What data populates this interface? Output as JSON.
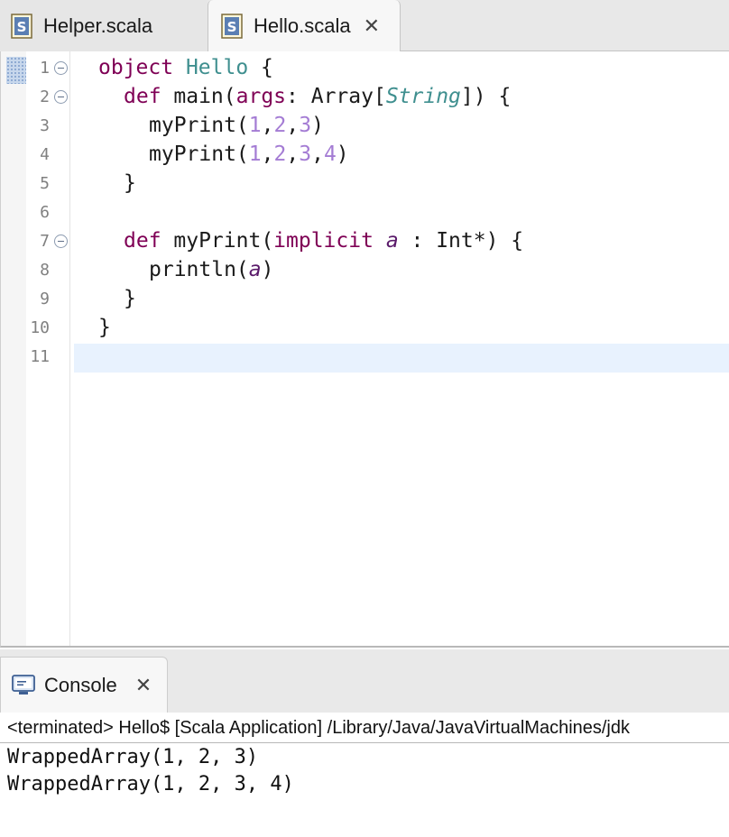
{
  "editor_tabs": [
    {
      "label": "Helper.scala",
      "icon": "scala-file-icon",
      "active": false
    },
    {
      "label": "Hello.scala",
      "icon": "scala-file-icon",
      "active": true,
      "close": "✕"
    }
  ],
  "editor": {
    "line_numbers": [
      "1",
      "2",
      "3",
      "4",
      "5",
      "6",
      "7",
      "8",
      "9",
      "10",
      "11"
    ],
    "current_line": 11,
    "code": {
      "l1": {
        "kw": "object",
        "name": "Hello",
        "rest": " {"
      },
      "l2": {
        "kw": "def",
        "pre": " main(",
        "param": "args",
        "mid": ": Array[",
        "type": "String",
        "post": "]) {"
      },
      "l3": {
        "pre": "myPrint(",
        "n1": "1",
        "c1": ",",
        "n2": "2",
        "c2": ",",
        "n3": "3",
        "post": ")"
      },
      "l4": {
        "pre": "myPrint(",
        "n1": "1",
        "c1": ",",
        "n2": "2",
        "c2": ",",
        "n3": "3",
        "c3": ",",
        "n4": "4",
        "post": ")"
      },
      "l5": "}",
      "l7": {
        "kw": "def",
        "pre": " myPrint(",
        "kw2": "implicit",
        "sp": " ",
        "param": "a",
        "post": " : Int*) {"
      },
      "l8": {
        "pre": "println(",
        "param": "a",
        "post": ")"
      },
      "l9": "}",
      "l10": "}"
    }
  },
  "console": {
    "tab_label": "Console",
    "tab_icon": "console-icon",
    "close": "✕",
    "status": "<terminated> Hello$ [Scala Application] /Library/Java/JavaVirtualMachines/jdk",
    "output": [
      "WrappedArray(1, 2, 3)",
      "WrappedArray(1, 2, 3, 4)"
    ]
  },
  "colors": {
    "keyword": "#7f0055",
    "type": "#3f8f8f",
    "number": "#a47cd4",
    "current_line": "#e8f2fe"
  }
}
